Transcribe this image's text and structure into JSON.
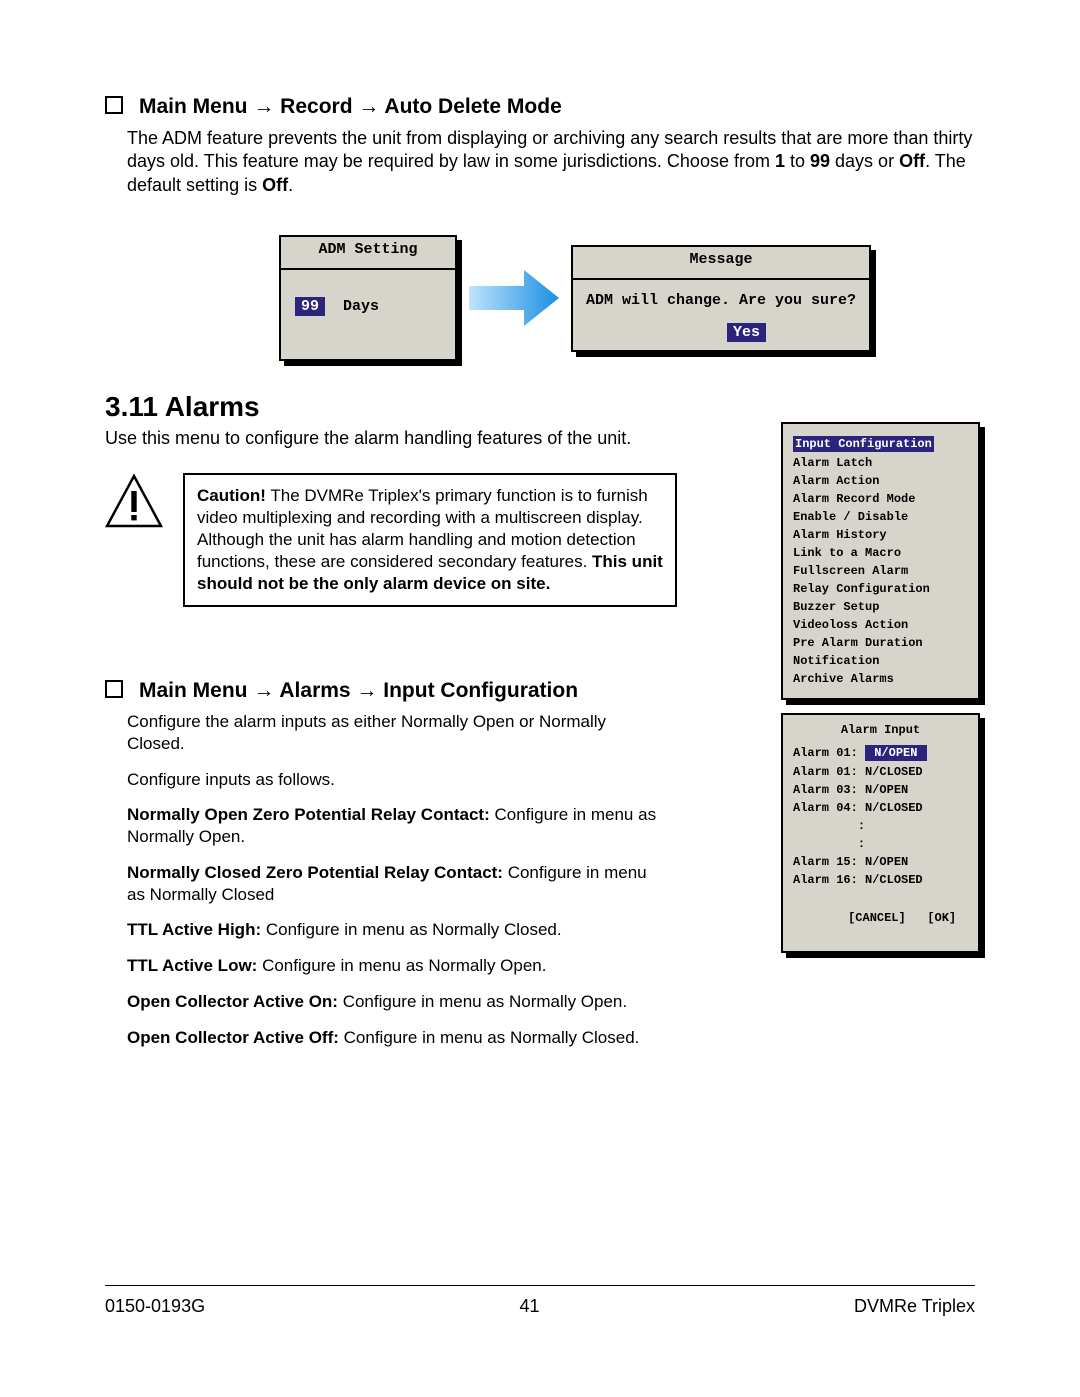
{
  "heading1": "Main Menu → Record → Auto Delete Mode",
  "adm_intro_1": "The ADM feature prevents the unit from displaying or archiving any search results that are more than thirty days old. This feature may be required by law in some jurisdictions.  Choose from ",
  "adm_intro_b1": "1",
  "adm_intro_2": " to ",
  "adm_intro_b2": "99",
  "adm_intro_3": " days or ",
  "adm_intro_b3": "Off",
  "adm_intro_4": ". The default setting is ",
  "adm_intro_b4": "Off",
  "adm_intro_5": ".",
  "adm_box": {
    "title": "ADM Setting",
    "value": "99",
    "unit": "Days"
  },
  "msg_box": {
    "title": "Message",
    "text": "ADM will change. Are you sure?",
    "yes": "Yes"
  },
  "section_title": "3.11 Alarms",
  "section_intro": "Use this menu to configure the alarm handling features of the unit.",
  "caution": {
    "lead": "Caution!",
    "body1": "  The DVMRe Triplex's primary function is to furnish video multiplexing and recording with a multiscreen display. Although the unit has alarm handling and motion detection functions, these are considered secondary features.  ",
    "bold_tail": "This unit should not be the only alarm device on site."
  },
  "config_menu": [
    "Input Configuration",
    "Alarm Latch",
    "Alarm Action",
    "Alarm Record Mode",
    "Enable / Disable",
    "Alarm History",
    "Link to a Macro",
    "Fullscreen Alarm",
    "Relay Configuration",
    "Buzzer Setup",
    "Videoloss Action",
    "Pre Alarm Duration",
    "Notification",
    "Archive Alarms"
  ],
  "heading2": "Main Menu → Alarms → Input Configuration",
  "paras": {
    "p1": "Configure the alarm inputs as either Normally Open or Normally Closed.",
    "p2": "Configure inputs as follows.",
    "p3b": "Normally Open Zero Potential Relay Contact:",
    "p3": "  Configure in menu as Normally Open.",
    "p4b": "Normally Closed Zero Potential Relay Contact:",
    "p4": "  Configure in menu as Normally Closed",
    "p5b": "TTL Active High:",
    "p5": "  Configure in menu as Normally Closed.",
    "p6b": "TTL Active Low:",
    "p6": "  Configure in menu as Normally Open.",
    "p7b": "Open Collector Active On:",
    "p7": "  Configure in menu as Normally Open.",
    "p8b": "Open Collector Active Off:",
    "p8": "  Configure in menu as Normally Closed."
  },
  "input_menu": {
    "title": "Alarm Input",
    "rows": [
      {
        "label": "Alarm 01:",
        "val": "N/OPEN",
        "hl": true
      },
      {
        "label": "Alarm 01:",
        "val": "N/CLOSED"
      },
      {
        "label": "Alarm 03:",
        "val": "N/OPEN"
      },
      {
        "label": "Alarm 04:",
        "val": "N/CLOSED"
      },
      {
        "label": "        ",
        "val": ":"
      },
      {
        "label": "        ",
        "val": ":"
      },
      {
        "label": "Alarm 15:",
        "val": "N/OPEN"
      },
      {
        "label": "Alarm 16:",
        "val": "N/CLOSED"
      }
    ],
    "cancel": "[CANCEL]",
    "ok": "[OK]"
  },
  "footer": {
    "left": "0150-0193G",
    "center": "41",
    "right": "DVMRe Triplex"
  }
}
